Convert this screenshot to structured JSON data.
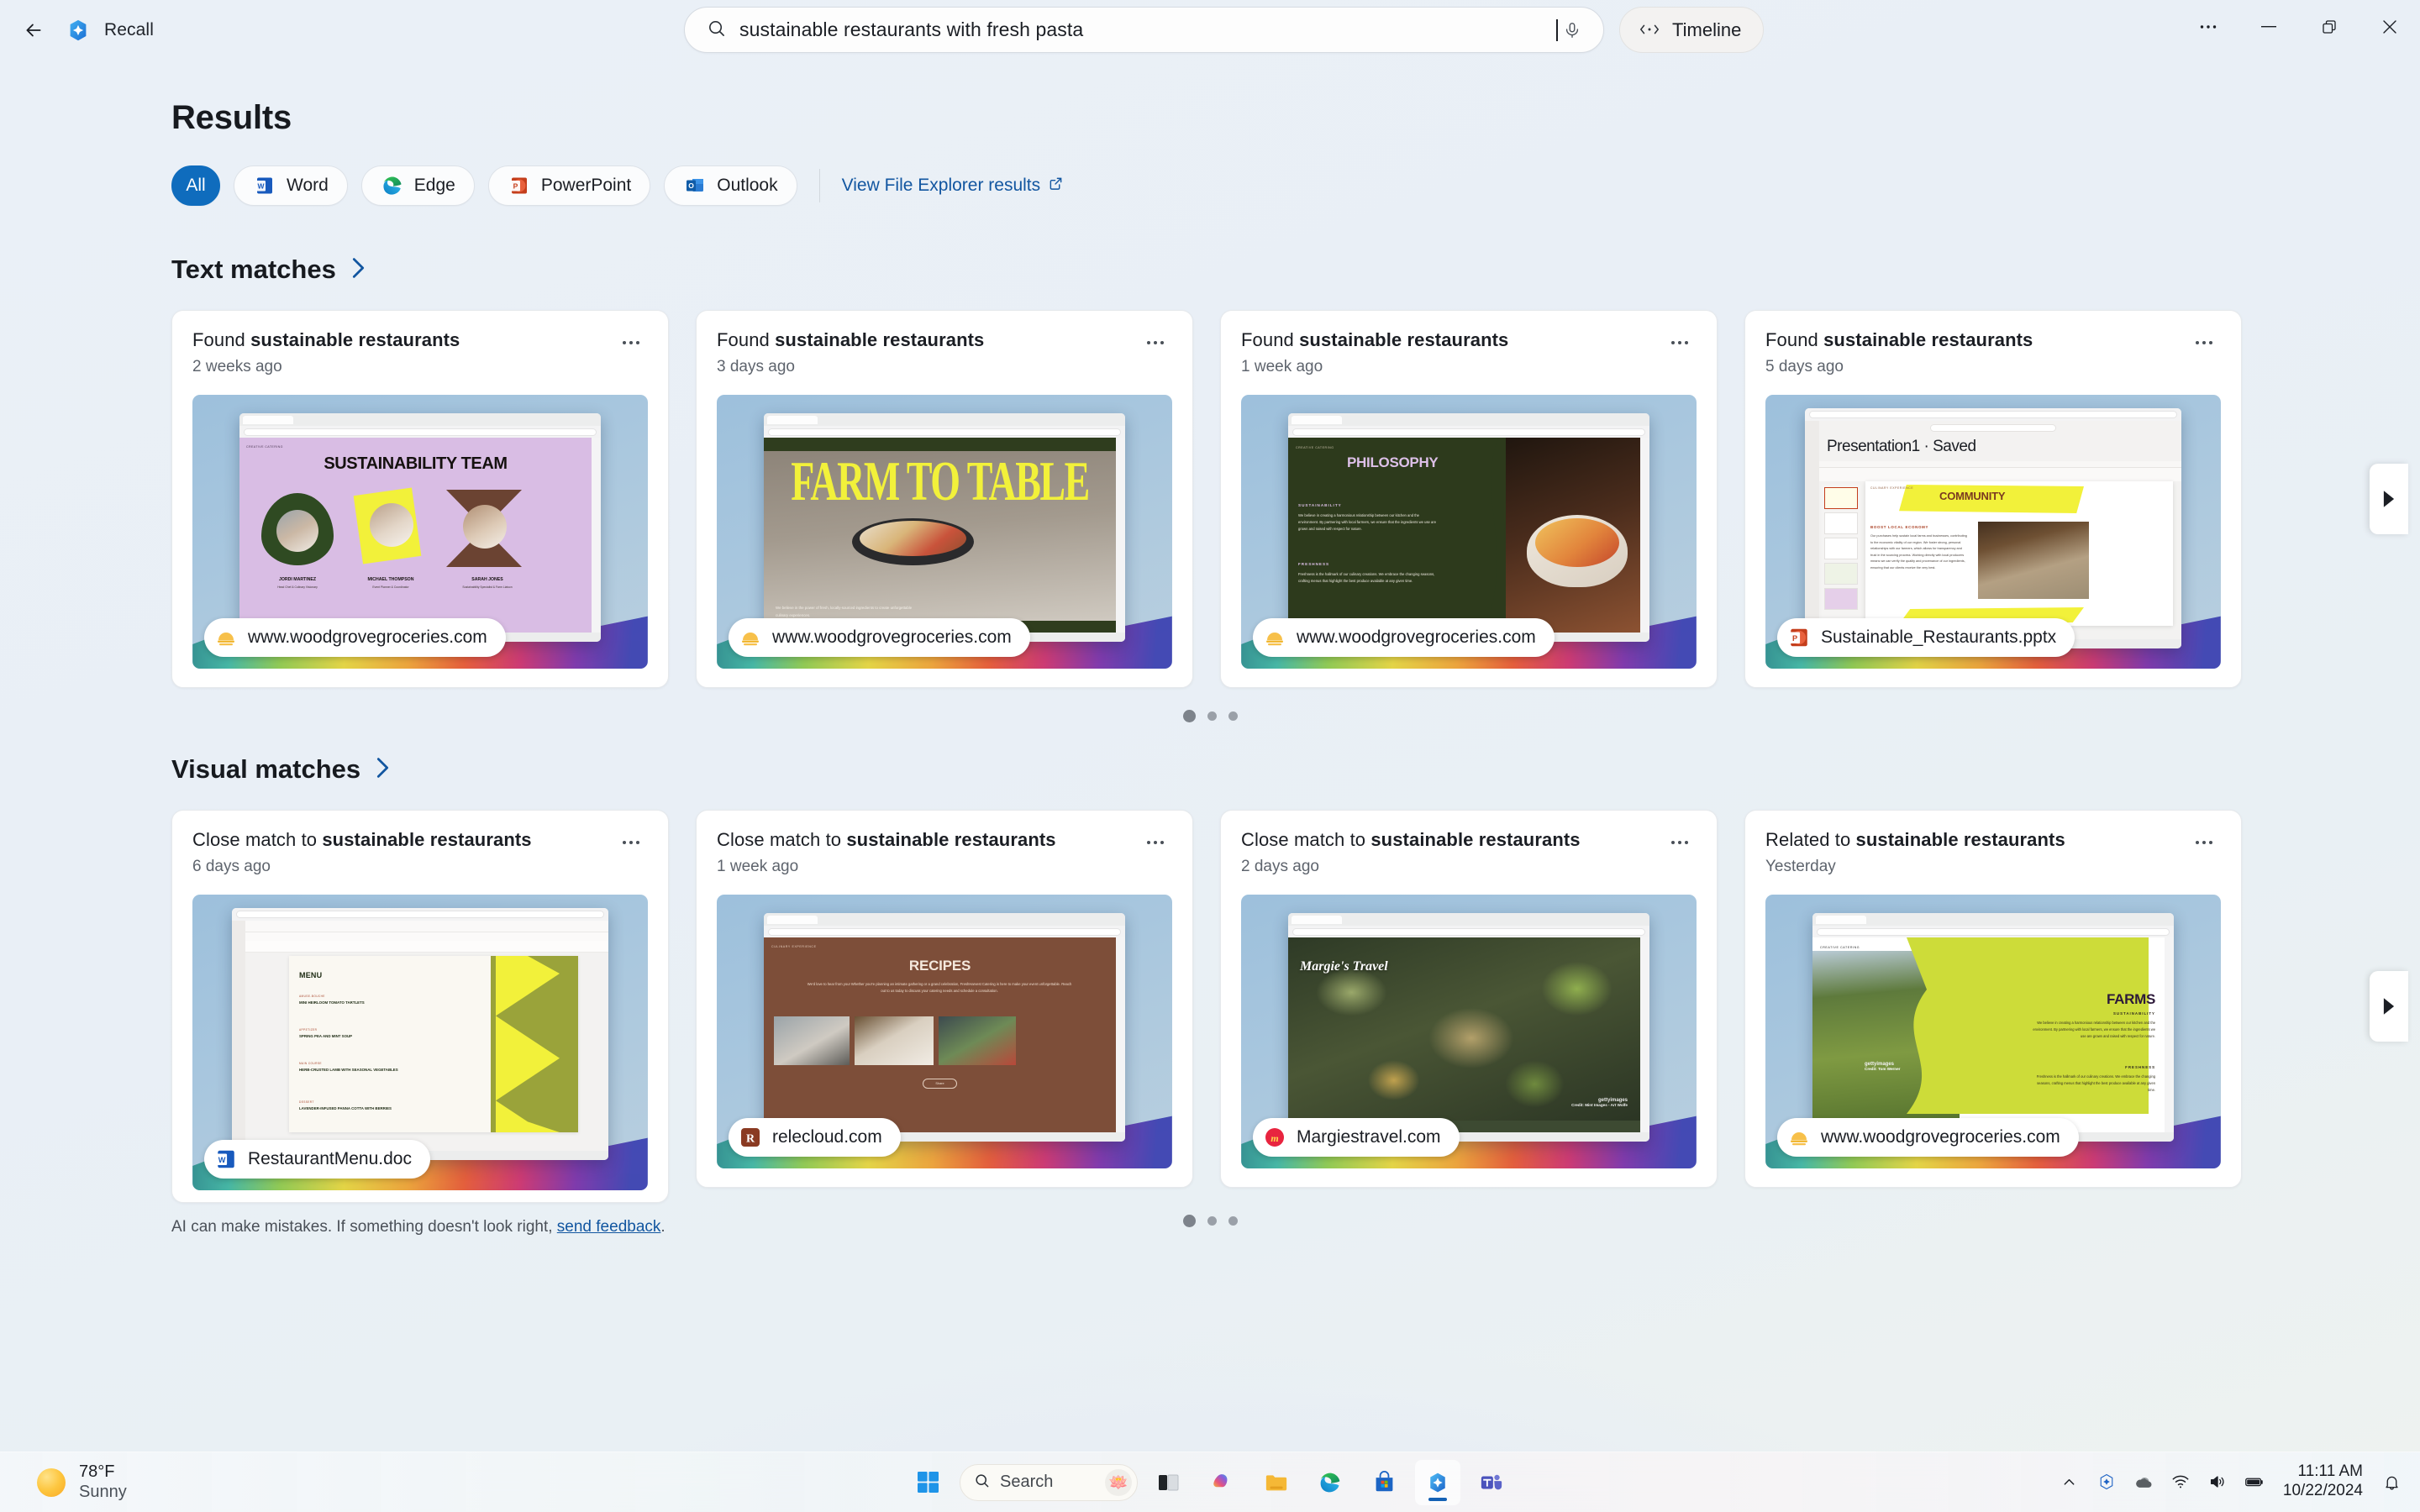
{
  "titlebar": {
    "back_label": "Back",
    "app_name": "Recall",
    "search": {
      "value": "sustainable restaurants with fresh pasta",
      "placeholder": "Search",
      "mic_label": "Search with voice"
    },
    "timeline_label": "Timeline",
    "window": {
      "more": "See more",
      "minimize": "Minimize",
      "restore": "Restore",
      "close": "Close"
    }
  },
  "page": {
    "heading": "Results",
    "filters": [
      {
        "label": "All",
        "icon": "all-filter",
        "active": true
      },
      {
        "label": "Word",
        "icon": "word-icon",
        "active": false
      },
      {
        "label": "Edge",
        "icon": "edge-icon",
        "active": false
      },
      {
        "label": "PowerPoint",
        "icon": "powerpoint-icon",
        "active": false
      },
      {
        "label": "Outlook",
        "icon": "outlook-icon",
        "active": false
      }
    ],
    "file_explorer_link": "View File Explorer results"
  },
  "sections": [
    {
      "title": "Text matches",
      "cards": [
        {
          "title_prefix": "Found ",
          "title_query": "sustainable restaurants",
          "time": "2 weeks ago",
          "badge": "www.woodgrovegroceries.com",
          "badge_icon": "woodgrove-icon",
          "slide": {
            "kind": "team",
            "eyebrow": "CREATIVE CATERING",
            "heading": "SUSTAINABILITY TEAM",
            "people": [
              {
                "name": "JORDI MARTINEZ",
                "role": "Head Chef & Culinary Visionary"
              },
              {
                "name": "MICHAEL THOMPSON",
                "role": "Event Planner & Coordinator"
              },
              {
                "name": "SARAH JONES",
                "role": "Sustainability Specialist & Farm Liaison"
              }
            ]
          }
        },
        {
          "title_prefix": "Found ",
          "title_query": "sustainable restaurants",
          "time": "3 days ago",
          "badge": "www.woodgrovegroceries.com",
          "badge_icon": "woodgrove-icon",
          "slide": {
            "kind": "farmtotable",
            "heading": "FARM TO TABLE",
            "body": "We believe in the power of fresh, locally-sourced ingredients to create unforgettable culinary experiences."
          }
        },
        {
          "title_prefix": "Found ",
          "title_query": "sustainable restaurants",
          "time": "1 week ago",
          "badge": "www.woodgrovegroceries.com",
          "badge_icon": "woodgrove-icon",
          "slide": {
            "kind": "philosophy",
            "eyebrow": "CREATIVE CATERING",
            "heading": "PHILOSOPHY",
            "blocks": [
              {
                "label": "SUSTAINABILITY",
                "text": "We believe in creating a harmonious relationship between our kitchen and the environment. By partnering with local farmers, we ensure that the ingredients we use are grown and raised with respect for nature."
              },
              {
                "label": "FRESHNESS",
                "text": "Freshness is the hallmark of our culinary creations. We embrace the changing seasons, crafting menus that highlight the best produce available at any given time."
              }
            ]
          }
        },
        {
          "title_prefix": "Found ",
          "title_query": "sustainable restaurants",
          "time": "5 days ago",
          "badge": "Sustainable_Restaurants.pptx",
          "badge_icon": "powerpoint-icon",
          "slide": {
            "kind": "community",
            "tooltip": "Presentation1 · Saved",
            "eyebrow": "CULINARY EXPERIENCE",
            "heading": "COMMUNITY",
            "sublabel": "BOOST LOCAL ECONOMY",
            "text": "Our purchases help sustain local farms and businesses, contributing to the economic vitality of our region. We foster strong, personal relationships with our farmers, which allows for transparency and trust in the sourcing process. Working directly with local producers means we can verify the quality and provenance of our ingredients, ensuring that our clients receive the very best."
          }
        }
      ],
      "dots": 3,
      "active_dot": 0
    },
    {
      "title": "Visual matches",
      "cards": [
        {
          "title_prefix": "Close match to ",
          "title_query": "sustainable restaurants",
          "time": "6 days ago",
          "badge": "RestaurantMenu.doc",
          "badge_icon": "word-icon",
          "slide": {
            "kind": "menu",
            "heading": "MENU",
            "items": [
              {
                "course": "AMUSE-BOUCHE",
                "name": "MINI HEIRLOOM TOMATO TARTLETS"
              },
              {
                "course": "APPETIZER",
                "name": "SPRING PEA AND MINT SOUP"
              },
              {
                "course": "MAIN COURSE",
                "name": "HERB-CRUSTED LAMB WITH SEASONAL VEGETABLES"
              },
              {
                "course": "DESSERT",
                "name": "LAVENDER-INFUSED PANNA COTTA WITH BERRIES"
              }
            ]
          }
        },
        {
          "title_prefix": "Close match to ",
          "title_query": "sustainable restaurants",
          "time": "1 week ago",
          "badge": "relecloud.com",
          "badge_icon": "relecloud-icon",
          "slide": {
            "kind": "recipes",
            "eyebrow": "CULINARY EXPERIENCE",
            "heading": "RECIPES",
            "body": "We'd love to hear from you! Whether you're planning an intimate gathering or a grand celebration, FreshHarvest Catering is here to make your event unforgettable. Reach out to us today to discuss your catering needs and schedule a consultation.",
            "cta": "Share"
          }
        },
        {
          "title_prefix": "Close match to ",
          "title_query": "sustainable restaurants",
          "time": "2 days ago",
          "badge": "Margiestravel.com",
          "badge_icon": "margies-icon",
          "slide": {
            "kind": "margies",
            "heading": "Margie's Travel",
            "credit_brand": "gettyimages",
            "credit": "Credit: Mint Images - Art Wolfe"
          }
        },
        {
          "title_prefix": "Related to ",
          "title_query": "sustainable restaurants",
          "time": "Yesterday",
          "badge": "www.woodgrovegroceries.com",
          "badge_icon": "woodgrove-icon",
          "slide": {
            "kind": "farms",
            "eyebrow": "CREATIVE CATERING",
            "heading": "FARMS",
            "credit_brand": "gettyimages",
            "credit": "Credit: Tom Werner",
            "blocks": [
              {
                "label": "SUSTAINABILITY",
                "text": "We believe in creating a harmonious relationship between our kitchen and the environment. By partnering with local farmers, we ensure that the ingredients we use are grown and raised with respect for nature."
              },
              {
                "label": "FRESHNESS",
                "text": "Freshness is the hallmark of our culinary creations. We embrace the changing seasons, crafting menus that highlight the best produce available at any given time."
              }
            ]
          }
        }
      ],
      "dots": 3,
      "active_dot": 0
    }
  ],
  "footer": {
    "disclaimer_before": "AI can make mistakes. If something doesn't look right, ",
    "link": "send feedback",
    "disclaimer_after": "."
  },
  "taskbar": {
    "weather": {
      "temp": "78°F",
      "condition": "Sunny"
    },
    "search_placeholder": "Search",
    "items": [
      {
        "name": "start-button",
        "label": "Start"
      },
      {
        "name": "task-view-button",
        "label": "Task view"
      },
      {
        "name": "copilot-button",
        "label": "Copilot"
      },
      {
        "name": "file-explorer-button",
        "label": "File Explorer"
      },
      {
        "name": "edge-button",
        "label": "Microsoft Edge"
      },
      {
        "name": "store-button",
        "label": "Microsoft Store"
      },
      {
        "name": "recall-button",
        "label": "Recall"
      },
      {
        "name": "teams-button",
        "label": "Microsoft Teams"
      }
    ],
    "tray": {
      "chevron": "Show hidden icons",
      "recall_tray": "Recall",
      "onedrive": "OneDrive",
      "wifi": "Network",
      "volume": "Volume",
      "battery": "Battery",
      "time": "11:11 AM",
      "date": "10/22/2024",
      "notifications": "Notifications"
    }
  },
  "colors": {
    "accent": "#0f6cbd",
    "link": "#1256a0",
    "card_bg": "#ffffff",
    "page_bg": "#e9eff6"
  }
}
